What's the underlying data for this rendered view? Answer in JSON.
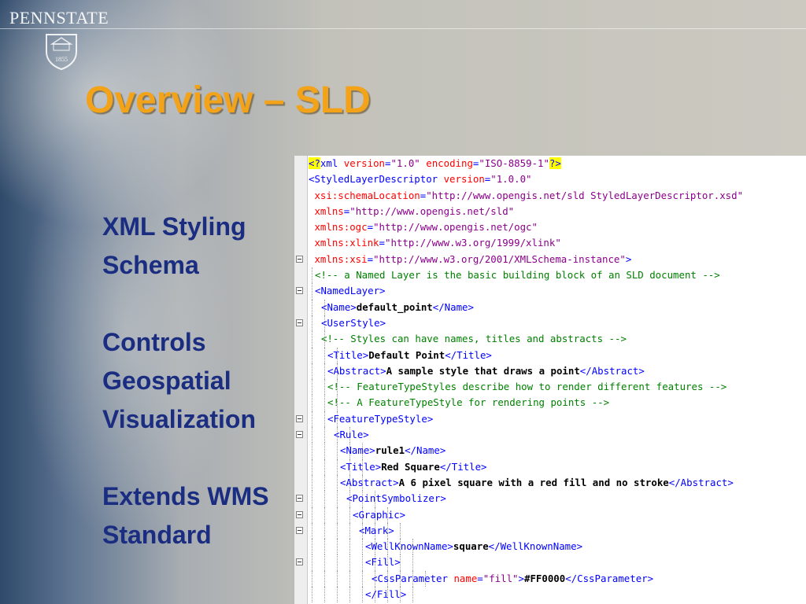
{
  "slide": {
    "logo": {
      "name": "PENNSTATE",
      "year": "1855"
    },
    "title": "Overview – SLD",
    "bullets": [
      "XML Styling",
      "Schema",
      "",
      "Controls",
      "Geospatial",
      "Visualization",
      "",
      "Extends WMS",
      "Standard"
    ]
  },
  "colors": {
    "title": "#f2a31a",
    "bullet_text": "#1a2d80",
    "xml_tag": "#0000ff",
    "xml_attr": "#ff0000",
    "xml_value": "#8b008b",
    "xml_comment": "#008000"
  },
  "code": {
    "lines": [
      {
        "fold": false,
        "depth": 0,
        "tokens": [
          [
            "pi",
            "<?"
          ],
          [
            "tag",
            "xml "
          ],
          [
            "attr",
            "version"
          ],
          [
            "tag",
            "="
          ],
          [
            "val",
            "\"1.0\""
          ],
          [
            "tag",
            " "
          ],
          [
            "attr",
            "encoding"
          ],
          [
            "tag",
            "="
          ],
          [
            "val",
            "\"ISO-8859-1\""
          ],
          [
            "pi",
            "?>"
          ]
        ]
      },
      {
        "fold": false,
        "depth": 0,
        "tokens": [
          [
            "tag",
            "<StyledLayerDescriptor "
          ],
          [
            "attr",
            "version"
          ],
          [
            "tag",
            "="
          ],
          [
            "val",
            "\"1.0.0\""
          ]
        ]
      },
      {
        "fold": false,
        "depth": 0,
        "tokens": [
          [
            "attr",
            " xsi:schemaLocation"
          ],
          [
            "tag",
            "="
          ],
          [
            "val",
            "\"http://www.opengis.net/sld StyledLayerDescriptor.xsd\""
          ]
        ]
      },
      {
        "fold": false,
        "depth": 0,
        "tokens": [
          [
            "attr",
            " xmlns"
          ],
          [
            "tag",
            "="
          ],
          [
            "val",
            "\"http://www.opengis.net/sld\""
          ]
        ]
      },
      {
        "fold": false,
        "depth": 0,
        "tokens": [
          [
            "attr",
            " xmlns:ogc"
          ],
          [
            "tag",
            "="
          ],
          [
            "val",
            "\"http://www.opengis.net/ogc\""
          ]
        ]
      },
      {
        "fold": false,
        "depth": 0,
        "tokens": [
          [
            "attr",
            " xmlns:xlink"
          ],
          [
            "tag",
            "="
          ],
          [
            "val",
            "\"http://www.w3.org/1999/xlink\""
          ]
        ]
      },
      {
        "fold": true,
        "depth": 0,
        "tokens": [
          [
            "attr",
            " xmlns:xsi"
          ],
          [
            "tag",
            "="
          ],
          [
            "val",
            "\"http://www.w3.org/2001/XMLSchema-instance\""
          ],
          [
            "tag",
            ">"
          ]
        ]
      },
      {
        "fold": false,
        "depth": 1,
        "tokens": [
          [
            "comment",
            "<!-- a Named Layer is the basic building block of an SLD document -->"
          ]
        ]
      },
      {
        "fold": true,
        "depth": 1,
        "tokens": [
          [
            "tag",
            "<NamedLayer>"
          ]
        ]
      },
      {
        "fold": false,
        "depth": 2,
        "tokens": [
          [
            "tag",
            "<Name>"
          ],
          [
            "text",
            "default_point"
          ],
          [
            "tag",
            "</Name>"
          ]
        ]
      },
      {
        "fold": true,
        "depth": 2,
        "tokens": [
          [
            "tag",
            "<UserStyle>"
          ]
        ]
      },
      {
        "fold": false,
        "depth": 2,
        "tokens": [
          [
            "comment",
            "<!-- Styles can have names, titles and abstracts -->"
          ]
        ]
      },
      {
        "fold": false,
        "depth": 3,
        "tokens": [
          [
            "tag",
            "<Title>"
          ],
          [
            "text",
            "Default Point"
          ],
          [
            "tag",
            "</Title>"
          ]
        ]
      },
      {
        "fold": false,
        "depth": 3,
        "tokens": [
          [
            "tag",
            "<Abstract>"
          ],
          [
            "text",
            "A sample style that draws a point"
          ],
          [
            "tag",
            "</Abstract>"
          ]
        ]
      },
      {
        "fold": false,
        "depth": 3,
        "tokens": [
          [
            "comment",
            "<!-- FeatureTypeStyles describe how to render different features -->"
          ]
        ]
      },
      {
        "fold": false,
        "depth": 3,
        "tokens": [
          [
            "comment",
            "<!-- A FeatureTypeStyle for rendering points -->"
          ]
        ]
      },
      {
        "fold": true,
        "depth": 3,
        "tokens": [
          [
            "tag",
            "<FeatureTypeStyle>"
          ]
        ]
      },
      {
        "fold": true,
        "depth": 4,
        "tokens": [
          [
            "tag",
            "<Rule>"
          ]
        ]
      },
      {
        "fold": false,
        "depth": 5,
        "tokens": [
          [
            "tag",
            "<Name>"
          ],
          [
            "text",
            "rule1"
          ],
          [
            "tag",
            "</Name>"
          ]
        ]
      },
      {
        "fold": false,
        "depth": 5,
        "tokens": [
          [
            "tag",
            "<Title>"
          ],
          [
            "text",
            "Red Square"
          ],
          [
            "tag",
            "</Title>"
          ]
        ]
      },
      {
        "fold": false,
        "depth": 5,
        "tokens": [
          [
            "tag",
            "<Abstract>"
          ],
          [
            "text",
            "A 6 pixel square with a red fill and no stroke"
          ],
          [
            "tag",
            "</Abstract>"
          ]
        ]
      },
      {
        "fold": true,
        "depth": 6,
        "tokens": [
          [
            "tag",
            "<PointSymbolizer>"
          ]
        ]
      },
      {
        "fold": true,
        "depth": 7,
        "tokens": [
          [
            "tag",
            "<Graphic>"
          ]
        ]
      },
      {
        "fold": true,
        "depth": 8,
        "tokens": [
          [
            "tag",
            "<Mark>"
          ]
        ]
      },
      {
        "fold": false,
        "depth": 9,
        "tokens": [
          [
            "tag",
            "<WellKnownName>"
          ],
          [
            "text",
            "square"
          ],
          [
            "tag",
            "</WellKnownName>"
          ]
        ]
      },
      {
        "fold": true,
        "depth": 9,
        "tokens": [
          [
            "tag",
            "<Fill>"
          ]
        ]
      },
      {
        "fold": false,
        "depth": 10,
        "tokens": [
          [
            "tag",
            "<CssParameter "
          ],
          [
            "attr",
            "name"
          ],
          [
            "tag",
            "="
          ],
          [
            "val",
            "\"fill\""
          ],
          [
            "tag",
            ">"
          ],
          [
            "text",
            "#FF0000"
          ],
          [
            "tag",
            "</CssParameter>"
          ]
        ]
      },
      {
        "fold": false,
        "depth": 9,
        "tokens": [
          [
            "tag",
            "</Fill>"
          ]
        ]
      }
    ]
  }
}
